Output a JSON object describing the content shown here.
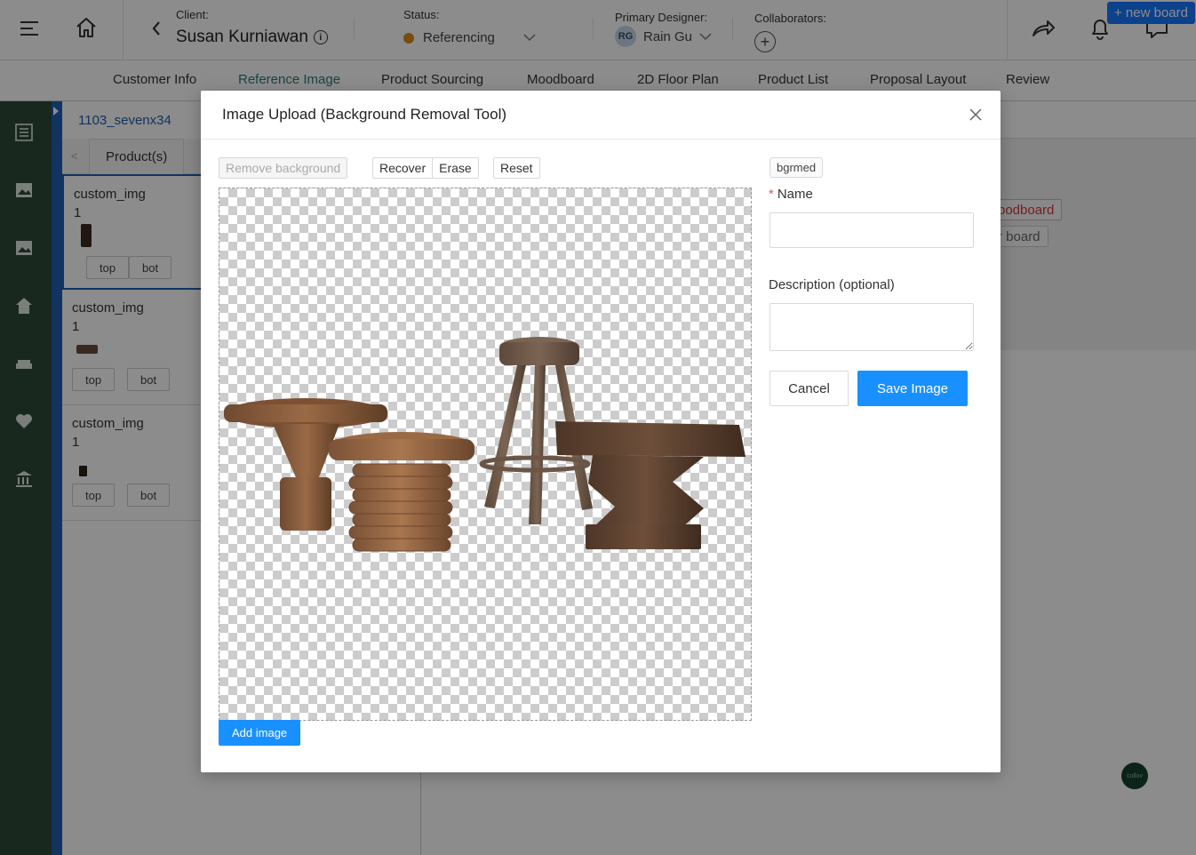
{
  "header": {
    "client_label": "Client:",
    "client_name": "Susan Kurniawan",
    "status_label": "Status:",
    "status_value": "Referencing",
    "designer_label": "Primary Designer:",
    "designer_initials": "RG",
    "designer_name": "Rain Gu",
    "collaborators_label": "Collaborators:",
    "new_board_label": "+ new board"
  },
  "tabs": [
    {
      "label": "Customer Info"
    },
    {
      "label": "Reference Image"
    },
    {
      "label": "Product Sourcing"
    },
    {
      "label": "Moodboard"
    },
    {
      "label": "2D Floor Plan"
    },
    {
      "label": "Product List"
    },
    {
      "label": "Proposal Layout"
    },
    {
      "label": "Review"
    }
  ],
  "active_tab": "Reference Image",
  "background": {
    "board_title": "1103_sevenx34",
    "subtab_prev": "<",
    "subtab_label": "Product(s)",
    "cards": [
      {
        "title": "custom_img",
        "count": "1",
        "buttons": [
          "top",
          "bot"
        ]
      },
      {
        "title": "custom_img",
        "count": "1",
        "buttons": [
          "top",
          "bot"
        ]
      },
      {
        "title": "custom_img",
        "count": "1",
        "buttons": [
          "top",
          "bot"
        ]
      }
    ],
    "tag_red": "oodboard",
    "tag_gray": "r board",
    "logo_text": "collov"
  },
  "modal": {
    "title": "Image Upload (Background Removal Tool)",
    "remove_bg_label": "Remove background",
    "recover_label": "Recover",
    "erase_label": "Erase",
    "reset_label": "Reset",
    "add_image_label": "Add image",
    "tag": "bgrmed",
    "name_label": "Name",
    "name_value": "",
    "description_label": "Description (optional)",
    "description_value": "",
    "cancel_label": "Cancel",
    "save_label": "Save Image"
  },
  "colors": {
    "primary": "#1890ff",
    "rail": "#2e4a3a",
    "active_tab": "#2a7a7a",
    "status_dot": "#d98a1a"
  }
}
